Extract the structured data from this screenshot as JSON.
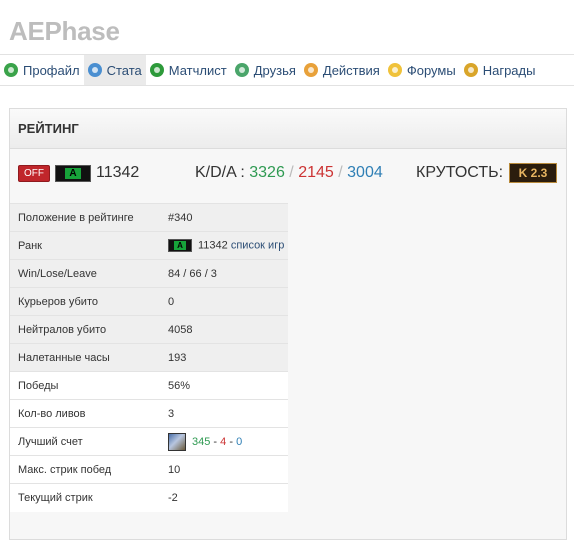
{
  "app": {
    "title": "AEPhase"
  },
  "nav": {
    "items": [
      {
        "label": "Профайл",
        "icon": "profile-icon"
      },
      {
        "label": "Стата",
        "icon": "stats-icon",
        "active": true
      },
      {
        "label": "Матчлист",
        "icon": "matchlist-icon"
      },
      {
        "label": "Друзья",
        "icon": "friends-icon"
      },
      {
        "label": "Действия",
        "icon": "actions-icon"
      },
      {
        "label": "Форумы",
        "icon": "forum-icon"
      },
      {
        "label": "Награды",
        "icon": "awards-icon"
      }
    ]
  },
  "rating": {
    "header": "РЕЙТИНГ",
    "status_badge": "OFF",
    "rank_letter": "A",
    "rating_value": "11342",
    "kda_label": "K/D/A :",
    "kills": "3326",
    "deaths": "2145",
    "assists": "3004",
    "sep": "/",
    "coolness_label": "КРУТОСТЬ:",
    "coolness_badge": "K 2.3"
  },
  "stats": {
    "rows": [
      {
        "label": "Положение в рейтинге",
        "value": "#340"
      },
      {
        "label": "Ранк",
        "rank_letter": "A",
        "value": "11342",
        "link": "список игр"
      },
      {
        "label": "Win/Lose/Leave",
        "value": "84 / 66 / 3"
      },
      {
        "label": "Курьеров убито",
        "value": "0"
      },
      {
        "label": "Нейтралов убито",
        "value": "4058"
      },
      {
        "label": "Налетанные часы",
        "value": "193"
      },
      {
        "label": "Победы",
        "value": "56%"
      },
      {
        "label": "Кол-во ливов",
        "value": "3"
      },
      {
        "label": "Лучший счет",
        "best_k": "345",
        "best_d": "4",
        "best_a": "0",
        "dash": "-"
      },
      {
        "label": "Макс. стрик побед",
        "value": "10"
      },
      {
        "label": "Текущий стрик",
        "value": "-2"
      }
    ]
  },
  "colors": {
    "kills": "#2f9a52",
    "deaths": "#cc3333",
    "assists": "#2f7fb5",
    "nav_link": "#2b4d75",
    "off_badge": "#c0262b"
  }
}
